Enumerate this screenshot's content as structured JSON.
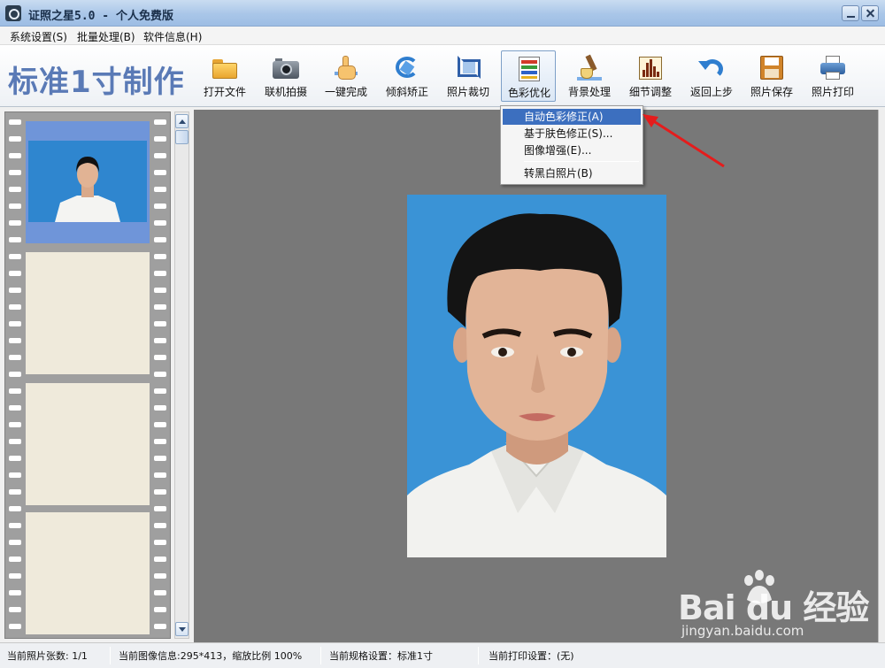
{
  "window": {
    "title": "证照之星5.0 - 个人免费版"
  },
  "menubar": {
    "items": [
      "系统设置(S)",
      "批量处理(B)",
      "软件信息(H)"
    ]
  },
  "toolbar": {
    "mode_title": "标准1寸制作",
    "tools": [
      {
        "label": "打开文件",
        "icon": "folder-icon"
      },
      {
        "label": "联机拍摄",
        "icon": "camera-icon"
      },
      {
        "label": "一键完成",
        "icon": "hand-icon"
      },
      {
        "label": "倾斜矫正",
        "icon": "rotate-icon"
      },
      {
        "label": "照片裁切",
        "icon": "crop-icon"
      },
      {
        "label": "色彩优化",
        "icon": "palette-icon",
        "active": true
      },
      {
        "label": "背景处理",
        "icon": "brush-icon"
      },
      {
        "label": "细节调整",
        "icon": "histogram-icon"
      },
      {
        "label": "返回上步",
        "icon": "undo-icon"
      },
      {
        "label": "照片保存",
        "icon": "floppy-icon"
      },
      {
        "label": "照片打印",
        "icon": "printer-icon"
      }
    ]
  },
  "dropdown": {
    "items": [
      {
        "label": "自动色彩修正(A)",
        "highlighted": true
      },
      {
        "label": "基于肤色修正(S)..."
      },
      {
        "label": "图像增强(E)..."
      },
      {
        "label": "转黑白照片(B)"
      }
    ]
  },
  "statusbar": {
    "photo_count": "当前照片张数: 1/1",
    "image_info": "当前图像信息:295*413，缩放比例 100%",
    "spec": "当前规格设置：标准1寸",
    "print": "当前打印设置：(无)"
  },
  "watermark": {
    "brand": "Bai du 经验",
    "url": "jingyan.baidu.com"
  },
  "colors": {
    "accent": "#5a7ab6",
    "menu_highlight": "#3c6fbf",
    "photo_background": "#3a93d6",
    "canvas": "#787878"
  }
}
